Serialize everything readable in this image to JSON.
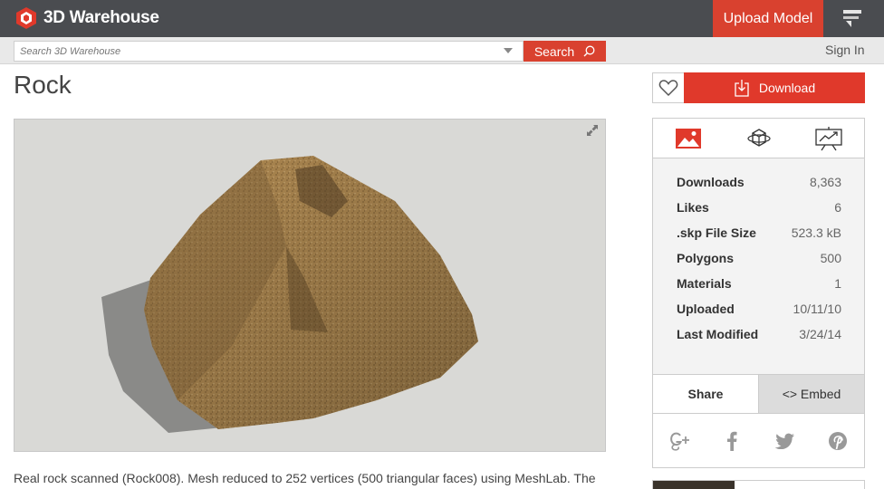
{
  "header": {
    "logo_text": "3D Warehouse",
    "upload_label": "Upload Model"
  },
  "search": {
    "placeholder": "Search 3D Warehouse",
    "button_label": "Search"
  },
  "auth": {
    "signin_label": "Sign In"
  },
  "model": {
    "title": "Rock",
    "description": "Real rock scanned (Rock008). Mesh reduced to 252 vertices (500 triangular faces) using MeshLab. The"
  },
  "actions": {
    "download_label": "Download"
  },
  "stats": [
    {
      "label": "Downloads",
      "value": "8,363"
    },
    {
      "label": "Likes",
      "value": "6"
    },
    {
      "label": ".skp File Size",
      "value": "523.3 kB"
    },
    {
      "label": "Polygons",
      "value": "500"
    },
    {
      "label": "Materials",
      "value": "1"
    },
    {
      "label": "Uploaded",
      "value": "10/11/10"
    },
    {
      "label": "Last Modified",
      "value": "3/24/14"
    }
  ],
  "share": {
    "share_tab": "Share",
    "embed_tab": "<> Embed"
  },
  "colors": {
    "brand_red": "#d9412f",
    "header_bg": "#4a4c50"
  },
  "icons": [
    "image-icon",
    "3d-rotate-icon",
    "presentation-icon",
    "google-plus-icon",
    "facebook-icon",
    "twitter-icon",
    "pinterest-icon",
    "heart-icon",
    "download-icon",
    "search-icon",
    "expand-icon"
  ]
}
